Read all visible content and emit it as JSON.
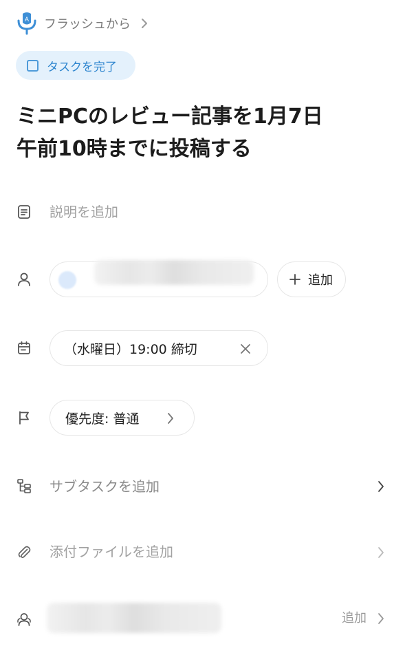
{
  "source": {
    "label": "フラッシュから",
    "accent_color": "#3e8fd6"
  },
  "complete_task": {
    "label": "タスクを完了"
  },
  "task": {
    "title_line1": "ミニPCのレビュー記事を1月7日",
    "title_line2": "午前10時までに投稿する"
  },
  "description": {
    "placeholder": "説明を追加"
  },
  "assignee": {
    "add_label": "追加"
  },
  "due": {
    "label": "（水曜日）19:00 締切"
  },
  "priority": {
    "label": "優先度: 普通"
  },
  "subtask": {
    "label": "サブタスクを追加"
  },
  "attachment": {
    "label": "添付ファイルを追加"
  },
  "followers": {
    "add_label": "追加"
  },
  "icons": {
    "source": "microphone-app-icon",
    "description": "note-icon",
    "assignee": "person-icon",
    "due": "calendar-icon",
    "priority": "flag-icon",
    "subtask": "subtask-tree-icon",
    "attachment": "paperclip-icon",
    "followers": "people-icon"
  }
}
